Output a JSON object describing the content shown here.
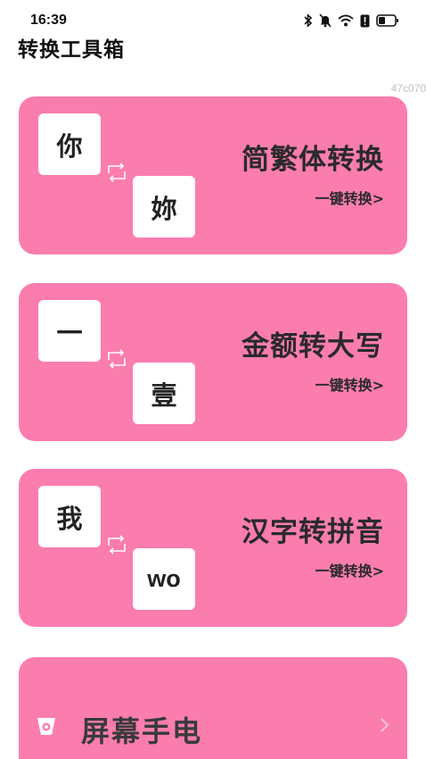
{
  "status_bar": {
    "time": "16:39",
    "icons": [
      "bluetooth-icon",
      "mute-icon",
      "wifi-icon",
      "alert-icon",
      "battery-icon"
    ]
  },
  "header": {
    "title": "转换工具箱",
    "tag": "47c070"
  },
  "colors": {
    "card": "#fb7dae",
    "text": "#2a2a2a",
    "box": "#ffffff",
    "tag": "#c0c0c0"
  },
  "cards": [
    {
      "from_char": "你",
      "to_char": "妳",
      "title": "简繁体转换",
      "action": "一键转换>"
    },
    {
      "from_char": "一",
      "to_char": "壹",
      "title": "金额转大写",
      "action": "一键转换>"
    },
    {
      "from_char": "我",
      "to_char": "wo",
      "title": "汉字转拼音",
      "action": "一键转换>"
    }
  ],
  "flashlight": {
    "label": "屏幕手电",
    "icon": "flashlight-icon",
    "chevron": "chevron-right-icon"
  }
}
